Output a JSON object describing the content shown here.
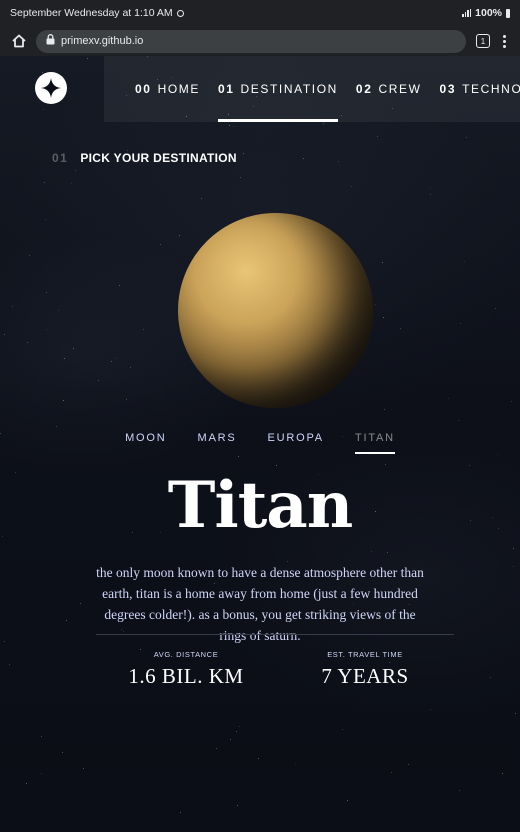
{
  "statusbar": {
    "time_text": "September Wednesday at 1:10 AM",
    "battery": "100%"
  },
  "browser": {
    "url": "primexv.github.io",
    "tab_count": "1"
  },
  "nav": {
    "items": [
      {
        "num": "00",
        "label": "HOME"
      },
      {
        "num": "01",
        "label": "DESTINATION"
      },
      {
        "num": "02",
        "label": "CREW"
      },
      {
        "num": "03",
        "label": "TECHNOLOGY"
      }
    ],
    "active_index": 1
  },
  "page": {
    "heading_num": "01",
    "heading_text": "PICK YOUR DESTINATION",
    "tabs": [
      "MOON",
      "MARS",
      "EUROPA",
      "TITAN"
    ],
    "active_tab": "TITAN",
    "destination": {
      "name": "Titan",
      "description": "the only moon known to have a dense atmosphere other than earth, titan is a home away from home (just a few hundred degrees colder!). as a bonus, you get striking views of the rings of saturn.",
      "distance_label": "AVG. DISTANCE",
      "distance_value": "1.6 BIL. KM",
      "travel_label": "EST. TRAVEL TIME",
      "travel_value": "7 YEARS"
    }
  },
  "colors": {
    "background": "#0b0d17",
    "accent_text": "#d0d6f9",
    "divider": "#383b4b",
    "planet": "#cba359"
  },
  "icons": {
    "logo": "star-logo-icon",
    "home": "home-icon",
    "lock": "lock-icon",
    "tabs": "tab-switcher-icon",
    "menu": "more-vert-icon"
  }
}
